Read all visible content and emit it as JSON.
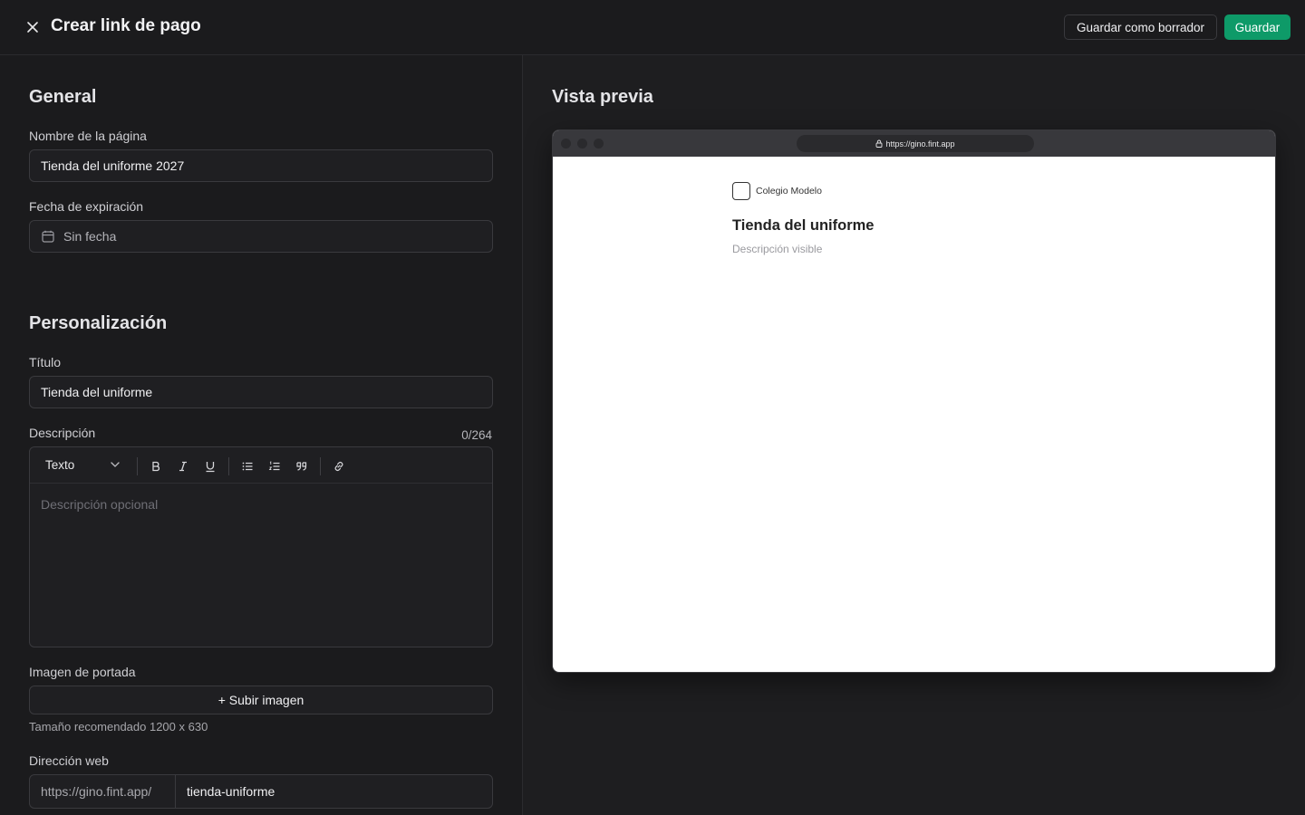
{
  "header": {
    "title": "Crear link de pago",
    "draft_label": "Guardar como borrador",
    "save_label": "Guardar"
  },
  "form": {
    "general": {
      "heading": "General",
      "page_name_label": "Nombre de la página",
      "page_name_value": "Tienda del uniforme 2027",
      "expiry_label": "Fecha de expiración",
      "expiry_value": "Sin fecha"
    },
    "customization": {
      "heading": "Personalización",
      "title_label": "Título",
      "title_value": "Tienda del uniforme",
      "description_label": "Descripción",
      "description_counter": "0/264",
      "text_style": "Texto",
      "description_placeholder": "Descripción opcional",
      "cover_label": "Imagen de portada",
      "upload_label": "+ Subir imagen",
      "cover_hint": "Tamaño recomendado 1200 x 630",
      "web_address_label": "Dirección web",
      "url_prefix": "https://gino.fint.app/",
      "url_slug": "tienda-uniforme"
    }
  },
  "preview": {
    "heading": "Vista previa",
    "address": "https://gino.fint.app",
    "org_name": "Colegio Modelo",
    "title": "Tienda del uniforme",
    "description": "Descripción visible"
  },
  "colors": {
    "accent": "#0e9a68",
    "background": "#1b1b1d"
  },
  "icons": [
    "close-icon",
    "calendar-icon",
    "chevron-down-icon",
    "bold-icon",
    "italic-icon",
    "underline-icon",
    "bullet-list-icon",
    "ordered-list-icon",
    "quote-icon",
    "link-icon",
    "lock-icon"
  ]
}
